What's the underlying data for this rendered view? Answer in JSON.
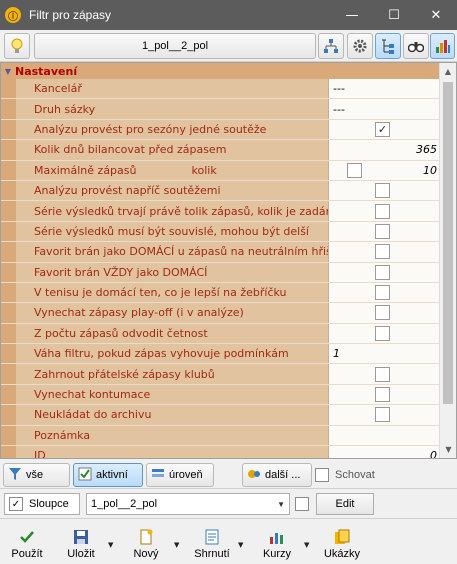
{
  "window": {
    "title": "Filtr pro zápasy",
    "minimize_glyph": "—",
    "maximize_glyph": "☐",
    "close_glyph": "✕"
  },
  "toolbar": {
    "filter_name": "1_pol__2_pol",
    "icons": [
      "lightbulb-icon",
      "hierarchy-icon",
      "settings-icon",
      "tree-view-icon",
      "binoculars-icon",
      "bar-chart-icon"
    ]
  },
  "grid": {
    "category": "Nastavení",
    "rows": [
      {
        "label": "Kancelář",
        "value": "---"
      },
      {
        "label": "Druh sázky",
        "value": "---"
      },
      {
        "label": "Analýzu provést pro sezóny jedné soutěže",
        "checked": true
      },
      {
        "label": "Kolik dnů bilancovat před zápasem",
        "number": "365"
      },
      {
        "label": "Maximálně zápasů",
        "sublabel": "kolik",
        "number": "10"
      },
      {
        "label": "Analýzu provést napříč soutěžemi",
        "checked": false
      },
      {
        "label": "Série výsledků trvají právě tolik zápasů, kolik je zadáno",
        "checked": false
      },
      {
        "label": "Série výsledků musí být souvislé, mohou být delší",
        "checked": false
      },
      {
        "label": "Favorit brán jako DOMÁCÍ u zápasů na neutrálním hřišti",
        "checked": false
      },
      {
        "label": "Favorit brán VŽDY jako DOMÁCÍ",
        "checked": false
      },
      {
        "label": "V tenisu je domácí ten, co je lepší na žebříčku",
        "checked": false
      },
      {
        "label": "Vynechat zápasy play-off (i v analýze)",
        "checked": false
      },
      {
        "label": "Z počtu zápasů odvodit četnost",
        "checked": false
      },
      {
        "label": "Váha filtru, pokud zápas vyhovuje podmínkám",
        "value_italic": "1"
      },
      {
        "label": "Zahrnout přátelské zápasy klubů",
        "checked": false
      },
      {
        "label": "Vynechat kontumace",
        "checked": false
      },
      {
        "label": "Neukládat do archivu",
        "checked": false
      },
      {
        "label": "Poznámka"
      },
      {
        "label": "ID",
        "number": "0"
      }
    ]
  },
  "filterbar": {
    "all_label": "vše",
    "active_label": "aktivní",
    "level_label": "úroveň",
    "more_label": "další ...",
    "hide_label": "Schovat"
  },
  "colbar": {
    "columns_label": "Sloupce",
    "combo_value": "1_pol__2_pol",
    "edit_label": "Edit"
  },
  "bottombar": {
    "use_label": "Použít",
    "save_label": "Uložit",
    "new_label": "Nový",
    "summary_label": "Shrnutí",
    "rates_label": "Kurzy",
    "samples_label": "Ukázky"
  }
}
